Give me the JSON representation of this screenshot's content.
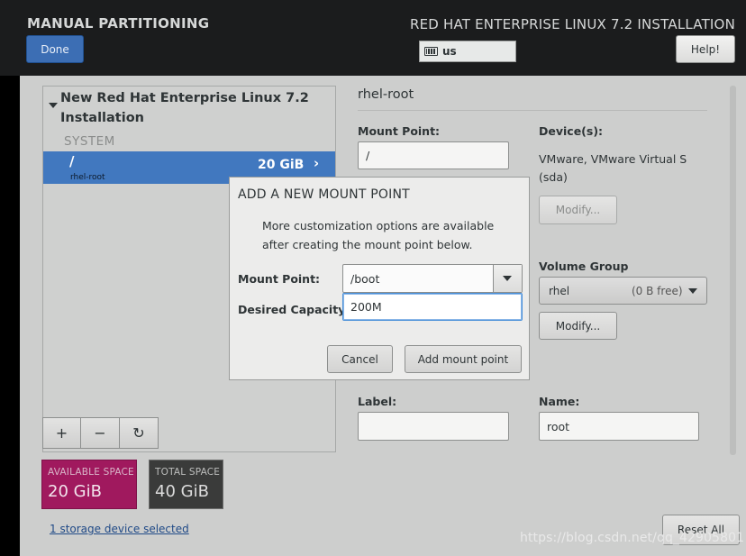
{
  "header": {
    "title": "MANUAL PARTITIONING",
    "done_label": "Done",
    "install_title": "RED HAT ENTERPRISE LINUX 7.2 INSTALLATION",
    "keyboard_layout": "us",
    "help_label": "Help!"
  },
  "left_panel": {
    "installation_title": "New Red Hat Enterprise Linux 7.2 Installation",
    "section_label": "SYSTEM",
    "mount_points": [
      {
        "path": "/",
        "device": "rhel-root",
        "size": "20 GiB"
      }
    ],
    "tools": {
      "add": "+",
      "remove": "−",
      "refresh": "↻"
    }
  },
  "space": {
    "available_label": "AVAILABLE SPACE",
    "available_value": "20 GiB",
    "total_label": "TOTAL SPACE",
    "total_value": "40 GiB"
  },
  "storage_link": "1 storage device selected",
  "details": {
    "title": "rhel-root",
    "mount_point_label": "Mount Point:",
    "mount_point_value": "/",
    "devices_label": "Device(s):",
    "devices_value": "VMware, VMware Virtual S (sda)",
    "modify_devices_label": "Modify...",
    "volume_group_label": "Volume Group",
    "volume_group_value": "rhel",
    "volume_group_free": "(0 B free)",
    "modify_vg_label": "Modify...",
    "label_label": "Label:",
    "label_value": "",
    "name_label": "Name:",
    "name_value": "root"
  },
  "reset_label": "Reset All",
  "dialog": {
    "title": "ADD A NEW MOUNT POINT",
    "description": "More customization options are available after creating the mount point below.",
    "mount_point_label": "Mount Point:",
    "mount_point_value": "/boot",
    "capacity_label": "Desired Capacity:",
    "capacity_value": "200M",
    "cancel_label": "Cancel",
    "add_label": "Add mount point"
  },
  "watermark": "https://blog.csdn.net/qq_42905801"
}
